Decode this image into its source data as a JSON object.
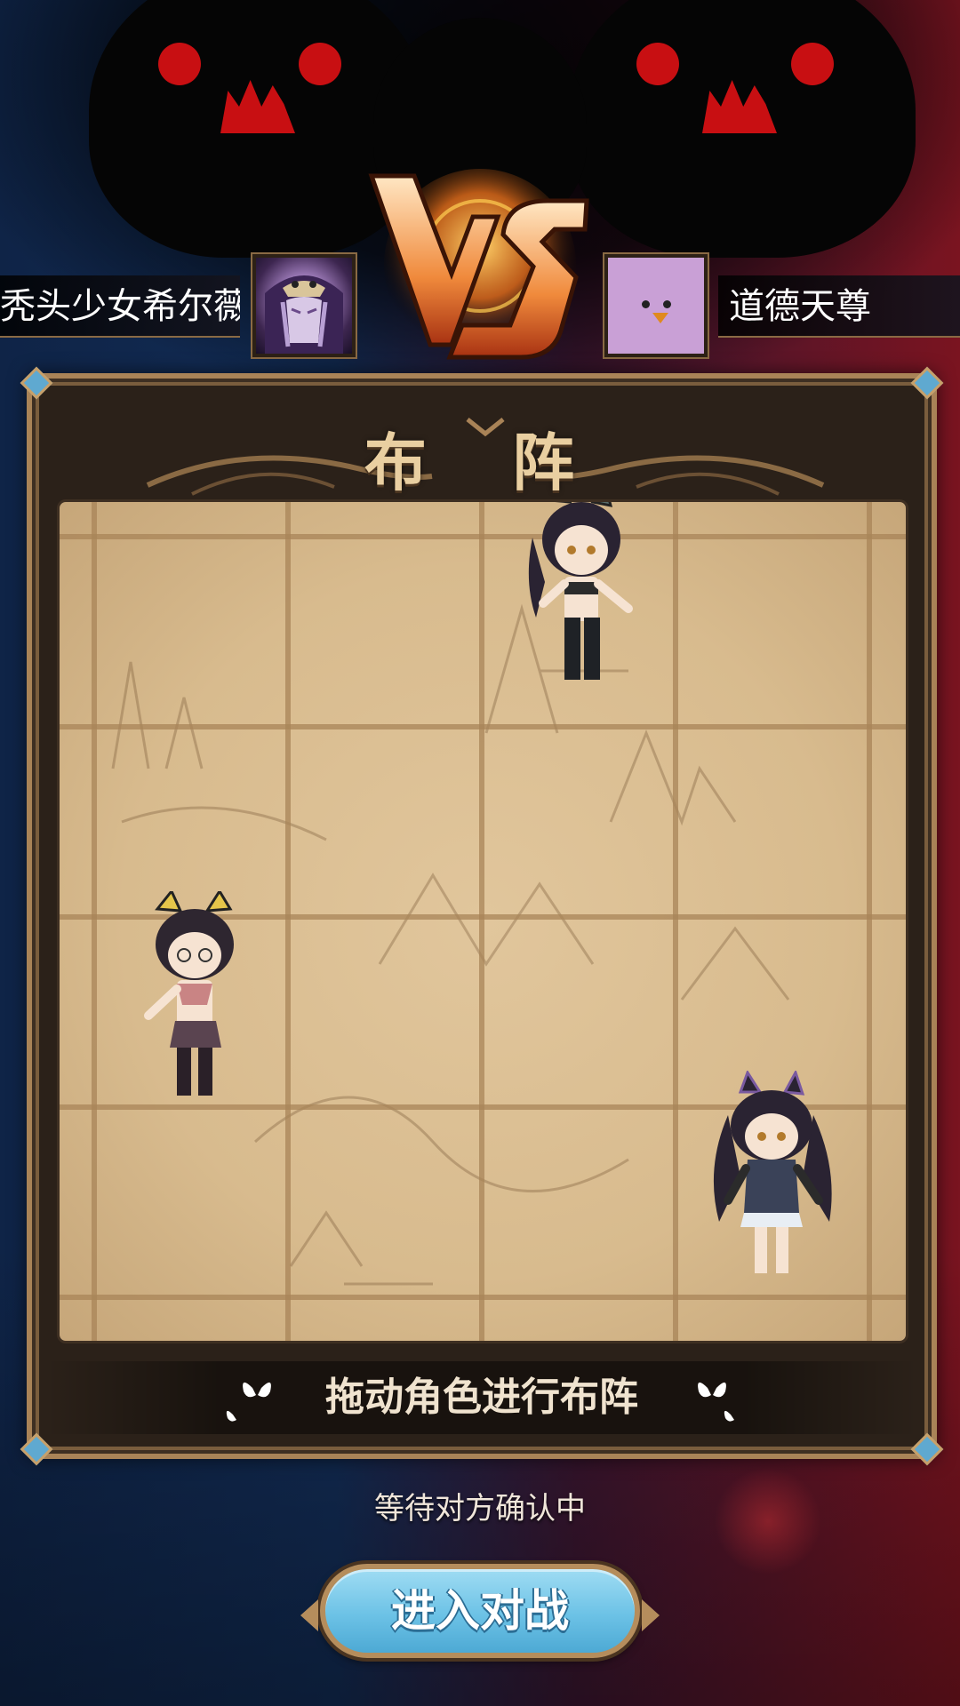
{
  "match": {
    "left_player_name": "秃头少女希尔薇",
    "right_player_name": "道德天尊",
    "vs_label": "VS"
  },
  "formation": {
    "title": "布 阵",
    "hint": "拖动角色进行布阵",
    "grid_columns": 4,
    "grid_rows": 4
  },
  "status": {
    "waiting_text": "等待对方确认中"
  },
  "actions": {
    "enter_battle_label": "进入对战"
  },
  "colors": {
    "accent_blue": "#6cc2e6",
    "frame_gold": "#a98357",
    "board_paper": "#d8bb8e",
    "monster_red": "#c80f12"
  }
}
